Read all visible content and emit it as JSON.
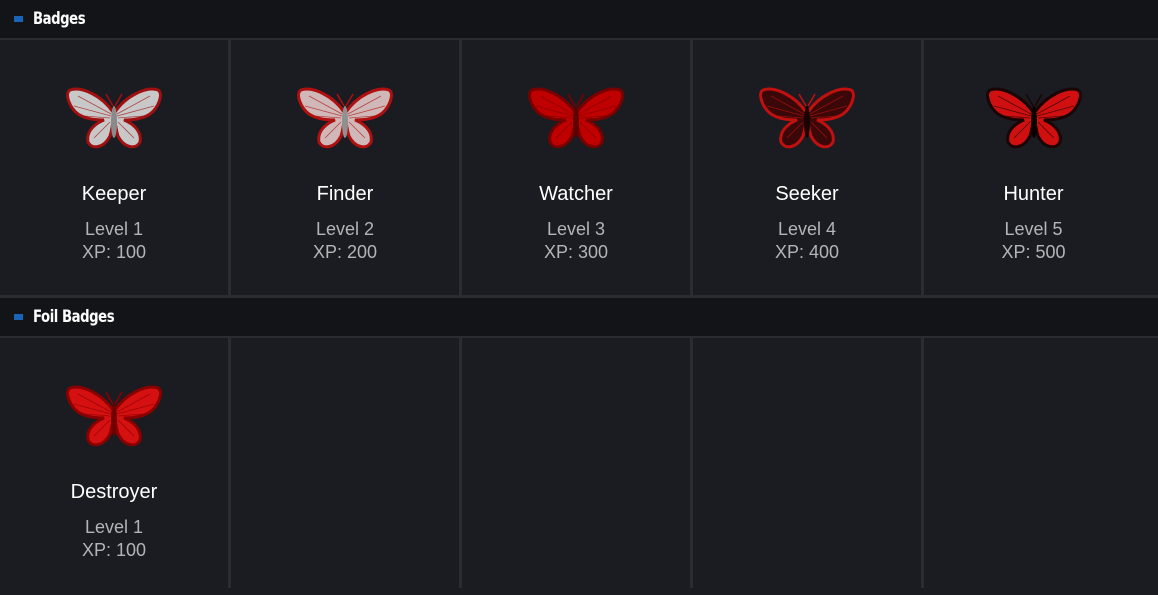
{
  "sections": [
    {
      "title": "Badges",
      "badges": [
        {
          "name": "Keeper",
          "level": "Level 1",
          "xp": "XP: 100",
          "icon": "butterfly-icon-white",
          "wing": "#c8c8c8",
          "edge": "#a01010",
          "body": "#8a8a8a"
        },
        {
          "name": "Finder",
          "level": "Level 2",
          "xp": "XP: 200",
          "icon": "butterfly-icon-pale",
          "wing": "#d0b8b8",
          "edge": "#b01010",
          "body": "#909090"
        },
        {
          "name": "Watcher",
          "level": "Level 3",
          "xp": "XP: 300",
          "icon": "butterfly-icon-red",
          "wing": "#c00000",
          "edge": "#7a0000",
          "body": "#600000"
        },
        {
          "name": "Seeker",
          "level": "Level 4",
          "xp": "XP: 400",
          "icon": "butterfly-icon-dark",
          "wing": "#3a0808",
          "edge": "#c01010",
          "body": "#1a0000"
        },
        {
          "name": "Hunter",
          "level": "Level 5",
          "xp": "XP: 500",
          "icon": "butterfly-icon-black-red",
          "wing": "#d01010",
          "edge": "#1a0404",
          "body": "#0a0000"
        }
      ]
    },
    {
      "title": "Foil Badges",
      "badges": [
        {
          "name": "Destroyer",
          "level": "Level 1",
          "xp": "XP: 100",
          "icon": "butterfly-icon-foil",
          "wing": "#d41010",
          "edge": "#8a0000",
          "body": "#700000"
        }
      ],
      "empty_slots": 4
    }
  ],
  "colors": {
    "accent": "#1a64b8",
    "background": "#1b1c21",
    "header_background": "#131417"
  }
}
